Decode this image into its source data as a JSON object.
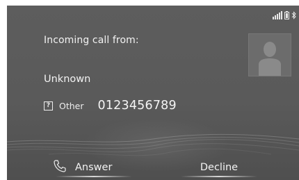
{
  "call": {
    "title": "Incoming call from:",
    "caller_name": "Unknown",
    "number_type": "Other",
    "number_type_icon_glyph": "?",
    "number": "0123456789"
  },
  "buttons": {
    "answer_label": "Answer",
    "decline_label": "Decline"
  },
  "status": {
    "icons": [
      "signal-bars-icon",
      "battery-icon",
      "bluetooth-icon"
    ]
  },
  "colors": {
    "background": "#5b5b5b",
    "text": "#f2f2f2",
    "avatar_tile": "#6c6c6c"
  }
}
